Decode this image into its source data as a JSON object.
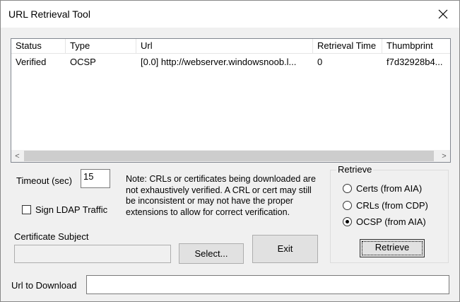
{
  "window": {
    "title": "URL Retrieval Tool",
    "close_glyph": "✕"
  },
  "list": {
    "columns": [
      "Status",
      "Type",
      "Url",
      "Retrieval Time",
      "Thumbprint"
    ],
    "rows": [
      [
        "Verified",
        "OCSP",
        "[0.0] http://webserver.windowsnoob.l...",
        "0",
        "f7d32928b4..."
      ]
    ],
    "scroll_left": "<",
    "scroll_right": ">"
  },
  "timeout": {
    "label": "Timeout (sec)",
    "value": "15"
  },
  "ldap": {
    "label": "Sign LDAP Traffic",
    "checked": false
  },
  "note": "Note: CRLs or certificates being downloaded are not exhaustively verified.  A CRL or cert may still be inconsistent or may not have the proper extensions to allow for correct verification.",
  "cert_subject": {
    "label": "Certificate Subject",
    "value": ""
  },
  "buttons": {
    "select": "Select...",
    "exit": "Exit",
    "retrieve": "Retrieve"
  },
  "retrieve_group": {
    "title": "Retrieve",
    "options": [
      "Certs (from AIA)",
      "CRLs (from CDP)",
      "OCSP (from AIA)"
    ],
    "selected": "OCSP (from AIA)"
  },
  "url_download": {
    "label": "Url to Download",
    "value": ""
  }
}
